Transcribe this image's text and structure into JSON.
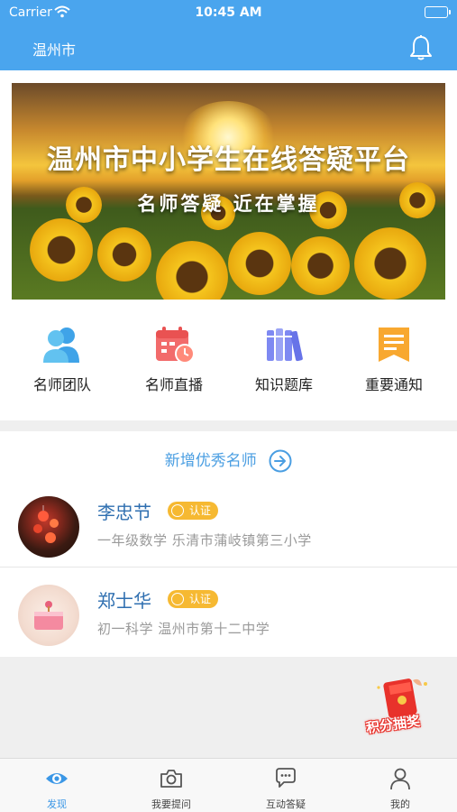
{
  "status_bar": {
    "carrier": "Carrier",
    "time": "10:45 AM"
  },
  "header": {
    "city": "温州市",
    "bell_icon": "bell-icon"
  },
  "banner": {
    "title": "温州市中小学生在线答疑平台",
    "subtitle": "名师答疑 近在掌握"
  },
  "quick_links": [
    {
      "label": "名师团队",
      "icon": "team-icon"
    },
    {
      "label": "名师直播",
      "icon": "calendar-live-icon"
    },
    {
      "label": "知识题库",
      "icon": "books-icon"
    },
    {
      "label": "重要通知",
      "icon": "notice-icon"
    }
  ],
  "teachers_section": {
    "heading": "新增优秀名师",
    "items": [
      {
        "name": "李忠节",
        "badge": "认证",
        "description": "一年级数学  乐清市蒲岐镇第三小学"
      },
      {
        "name": "郑士华",
        "badge": "认证",
        "description": "初一科学  温州市第十二中学"
      }
    ]
  },
  "floating": {
    "lottery_label": "积分抽奖"
  },
  "tab_bar": [
    {
      "label": "发现",
      "icon": "eye-icon",
      "active": true
    },
    {
      "label": "我要提问",
      "icon": "camera-icon",
      "active": false
    },
    {
      "label": "互动答疑",
      "icon": "chat-icon",
      "active": false
    },
    {
      "label": "我的",
      "icon": "user-icon",
      "active": false
    }
  ],
  "colors": {
    "brand": "#4aa5ee",
    "badge": "#f6b932",
    "tab_active": "#3b97e6",
    "name": "#2f6fb0"
  }
}
